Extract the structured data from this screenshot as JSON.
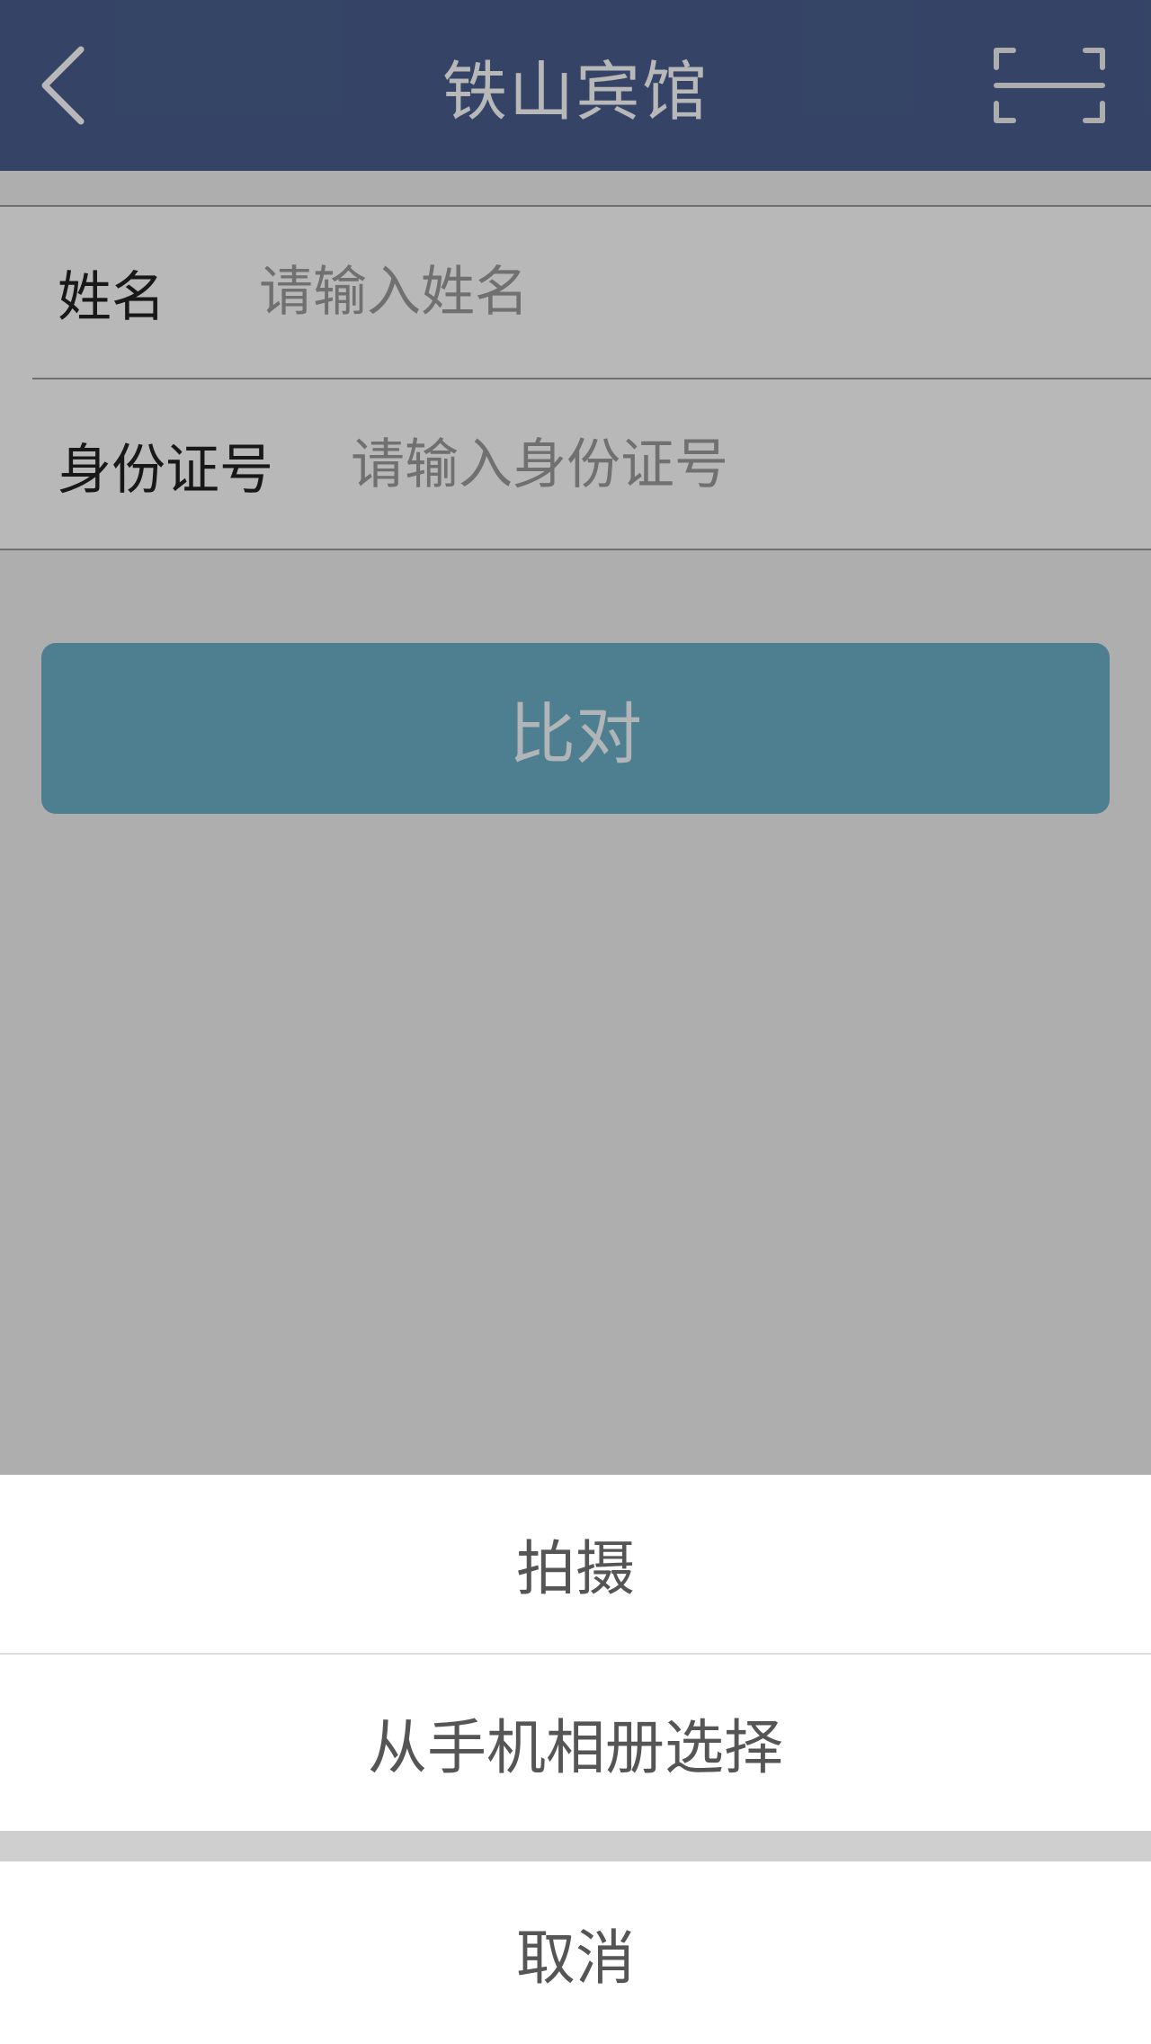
{
  "header": {
    "title": "铁山宾馆",
    "back_icon": "chevron-left-icon",
    "scan_icon": "scan-frame-icon"
  },
  "form": {
    "name_label": "姓名",
    "name_placeholder": "请输入姓名",
    "name_value": "",
    "id_label": "身份证号",
    "id_placeholder": "请输入身份证号",
    "id_value": ""
  },
  "compare_button": {
    "label": "比对"
  },
  "action_sheet": {
    "items": [
      {
        "label": "拍摄"
      },
      {
        "label": "从手机相册选择"
      }
    ],
    "cancel_label": "取消"
  },
  "colors": {
    "header_bg": "#4a5f8e",
    "button_bg": "#6bb0c8",
    "overlay": "rgba(0,0,0,0.28)",
    "sheet_bg": "#ffffff"
  }
}
